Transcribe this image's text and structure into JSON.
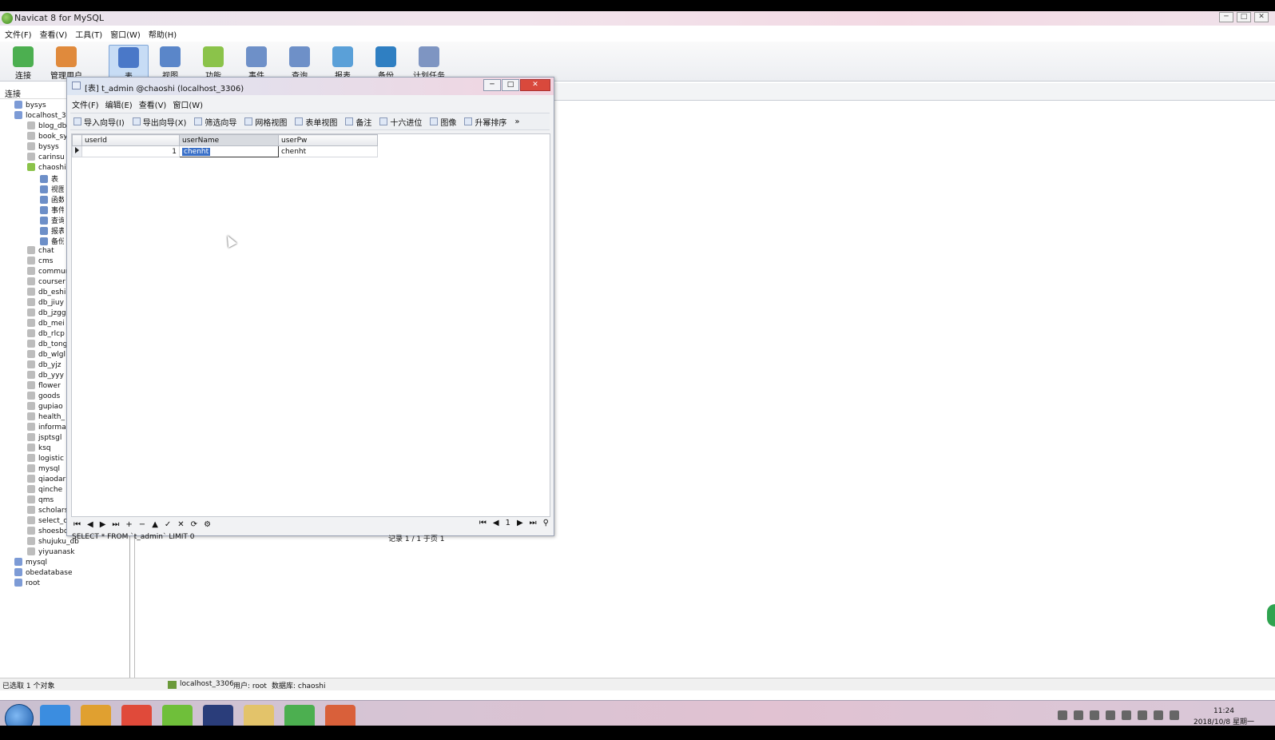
{
  "window": {
    "title": "Navicat 8 for MySQL",
    "btn_min": "─",
    "btn_max": "□",
    "btn_close": "✕"
  },
  "menu": [
    "文件(F)",
    "查看(V)",
    "工具(T)",
    "窗口(W)",
    "帮助(H)"
  ],
  "toolbar": [
    {
      "label": "连接",
      "icon": "connect-icon",
      "color": "#4caf50"
    },
    {
      "label": "管理用户",
      "icon": "user-icon",
      "color": "#e08a3c"
    },
    {
      "label": "表",
      "icon": "table-icon",
      "color": "#4a78c8",
      "active": true
    },
    {
      "label": "视图",
      "icon": "view-icon",
      "color": "#5a86c9"
    },
    {
      "label": "功能",
      "icon": "function-icon",
      "color": "#8bc34a"
    },
    {
      "label": "事件",
      "icon": "event-icon",
      "color": "#6e90c8"
    },
    {
      "label": "查询",
      "icon": "query-icon",
      "color": "#6e90c8"
    },
    {
      "label": "报表",
      "icon": "report-icon",
      "color": "#5aa0d8"
    },
    {
      "label": "备份",
      "icon": "backup-icon",
      "color": "#2f7fc2"
    },
    {
      "label": "计划任务",
      "icon": "schedule-icon",
      "color": "#7e95c2"
    }
  ],
  "left_pane": {
    "header": "连接",
    "tree": [
      {
        "label": "bysys",
        "type": "conn",
        "level": 1
      },
      {
        "label": "localhost_3",
        "type": "conn",
        "level": 1
      },
      {
        "label": "blog_db",
        "type": "gray",
        "level": 2
      },
      {
        "label": "book_sy",
        "type": "gray",
        "level": 2
      },
      {
        "label": "bysys",
        "type": "gray",
        "level": 2
      },
      {
        "label": "carinsu",
        "type": "gray",
        "level": 2
      },
      {
        "label": "chaoshi",
        "type": "db",
        "level": 2
      },
      {
        "label": "表",
        "type": "obj",
        "level": 3
      },
      {
        "label": "视图",
        "type": "obj",
        "level": 3
      },
      {
        "label": "函数",
        "type": "obj",
        "level": 3
      },
      {
        "label": "事件",
        "type": "obj",
        "level": 3
      },
      {
        "label": "查询",
        "type": "obj",
        "level": 3
      },
      {
        "label": "报表",
        "type": "obj",
        "level": 3
      },
      {
        "label": "备份",
        "type": "obj",
        "level": 3
      },
      {
        "label": "chat",
        "type": "gray",
        "level": 2
      },
      {
        "label": "cms",
        "type": "gray",
        "level": 2
      },
      {
        "label": "commun",
        "type": "gray",
        "level": 2
      },
      {
        "label": "courser",
        "type": "gray",
        "level": 2
      },
      {
        "label": "db_eshi",
        "type": "gray",
        "level": 2
      },
      {
        "label": "db_jiuy",
        "type": "gray",
        "level": 2
      },
      {
        "label": "db_jzgg",
        "type": "gray",
        "level": 2
      },
      {
        "label": "db_mei",
        "type": "gray",
        "level": 2
      },
      {
        "label": "db_rlcp",
        "type": "gray",
        "level": 2
      },
      {
        "label": "db_tong",
        "type": "gray",
        "level": 2
      },
      {
        "label": "db_wlgl",
        "type": "gray",
        "level": 2
      },
      {
        "label": "db_yjz",
        "type": "gray",
        "level": 2
      },
      {
        "label": "db_yyy",
        "type": "gray",
        "level": 2
      },
      {
        "label": "flower",
        "type": "gray",
        "level": 2
      },
      {
        "label": "goods",
        "type": "gray",
        "level": 2
      },
      {
        "label": "gupiao",
        "type": "gray",
        "level": 2
      },
      {
        "label": "health_",
        "type": "gray",
        "level": 2
      },
      {
        "label": "informa",
        "type": "gray",
        "level": 2
      },
      {
        "label": "jsptsgl",
        "type": "gray",
        "level": 2
      },
      {
        "label": "ksq",
        "type": "gray",
        "level": 2
      },
      {
        "label": "logistic",
        "type": "gray",
        "level": 2
      },
      {
        "label": "mysql",
        "type": "gray",
        "level": 2
      },
      {
        "label": "qiaodar",
        "type": "gray",
        "level": 2
      },
      {
        "label": "qinche",
        "type": "gray",
        "level": 2
      },
      {
        "label": "qms",
        "type": "gray",
        "level": 2
      },
      {
        "label": "scholars",
        "type": "gray",
        "level": 2
      },
      {
        "label": "select_c",
        "type": "gray",
        "level": 2
      },
      {
        "label": "shoesbox",
        "type": "gray",
        "level": 2
      },
      {
        "label": "shujuku_db",
        "type": "gray",
        "level": 2
      },
      {
        "label": "yiyuanask",
        "type": "gray",
        "level": 2
      },
      {
        "label": "mysql",
        "type": "conn",
        "level": 1
      },
      {
        "label": "obedatabase",
        "type": "conn",
        "level": 1
      },
      {
        "label": "root",
        "type": "conn",
        "level": 1
      }
    ]
  },
  "child_window": {
    "title": "[表] t_admin @chaoshi (localhost_3306)",
    "menu": [
      "文件(F)",
      "编辑(E)",
      "查看(V)",
      "窗口(W)"
    ],
    "toolbar": [
      "导入向导(I)",
      "导出向导(X)",
      "筛选向导",
      "网格视图",
      "表单视图",
      "备注",
      "十六进位",
      "图像",
      "升幂排序"
    ],
    "more": "»",
    "columns": [
      "userId",
      "userName",
      "userPw"
    ],
    "rows": [
      [
        "1",
        "chenht",
        "chenht"
      ]
    ],
    "nav_buttons": [
      "⏮",
      "◀",
      "▶",
      "⏭",
      "+",
      "−",
      "▲",
      "✓",
      "✕",
      "⟳",
      "⚙"
    ],
    "page_nav": {
      "first": "⏮",
      "prev": "◀",
      "page": "1",
      "next": "▶",
      "last": "⏭",
      "filter": "⚲"
    },
    "sql": "SELECT * FROM `t_admin` LIMIT 0",
    "record_info": "记录 1 / 1 于页 1"
  },
  "status_bar": {
    "left": "已选取 1 个对象",
    "connection": "localhost_3306",
    "user": "用户: root",
    "database": "数据库: chaoshi"
  },
  "taskbar": {
    "apps": [
      {
        "name": "ie-icon",
        "color": "#3b8de0"
      },
      {
        "name": "media-icon",
        "color": "#e0a030"
      },
      {
        "name": "chrome-icon",
        "color": "#e04a3a"
      },
      {
        "name": "navicat-icon",
        "color": "#6fbf3a"
      },
      {
        "name": "eclipse-icon",
        "color": "#2a3d7a"
      },
      {
        "name": "folder-icon",
        "color": "#e3c36a"
      },
      {
        "name": "chart-app-icon",
        "color": "#4caf50"
      },
      {
        "name": "recorder-icon",
        "color": "#d9603a"
      }
    ],
    "time": "11:24",
    "date": "2018/10/8 星期一"
  }
}
